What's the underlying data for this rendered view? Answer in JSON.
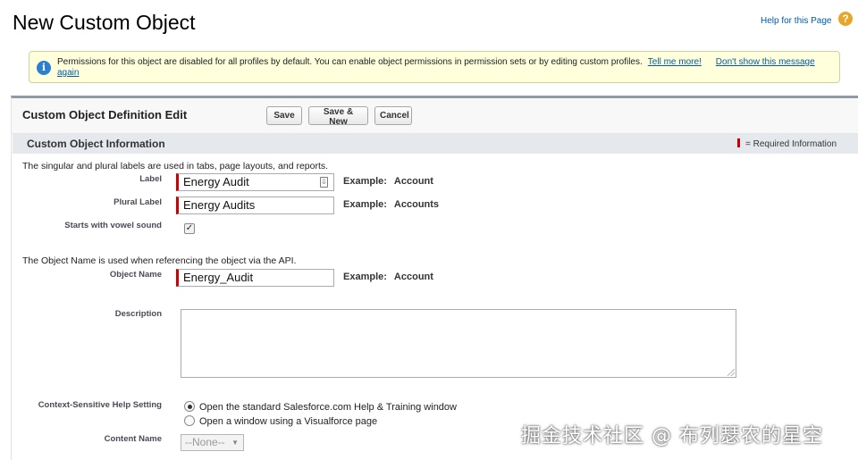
{
  "page": {
    "title": "New Custom Object",
    "help_link": "Help for this Page",
    "help_icon": "question-icon"
  },
  "notice": {
    "icon": "info-icon",
    "text": "Permissions for this object are disabled for all profiles by default. You can enable object permissions in permission sets or by editing custom profiles.",
    "tell_me_more": "Tell me more!",
    "dont_show": "Don't show this message again"
  },
  "edit": {
    "title": "Custom Object Definition Edit",
    "buttons": {
      "save": "Save",
      "save_new": "Save & New",
      "cancel": "Cancel"
    }
  },
  "section": {
    "title": "Custom Object Information",
    "required_legend": "= Required Information"
  },
  "labels_intro": "The singular and plural labels are used in tabs, page layouts, and reports.",
  "fields": {
    "label": {
      "label": "Label",
      "value": "Energy Audit",
      "example_label": "Example:",
      "example_value": "Account"
    },
    "plural_label": {
      "label": "Plural Label",
      "value": "Energy Audits",
      "example_label": "Example:",
      "example_value": "Accounts"
    },
    "vowel": {
      "label": "Starts with vowel sound",
      "checked": true
    },
    "object_name_intro": "The Object Name is used when referencing the object via the API.",
    "object_name": {
      "label": "Object Name",
      "value": "Energy_Audit",
      "example_label": "Example:",
      "example_value": "Account"
    },
    "description": {
      "label": "Description",
      "value": ""
    },
    "help_setting": {
      "label": "Context-Sensitive Help Setting",
      "options": [
        {
          "label": "Open the standard Salesforce.com Help & Training window",
          "selected": true
        },
        {
          "label": "Open a window using a Visualforce page",
          "selected": false
        }
      ]
    },
    "content_name": {
      "label": "Content Name",
      "value": "--None--"
    }
  },
  "watermark": "掘金技术社区 @ 布列瑟农的星空",
  "colors": {
    "required": "#cc0000",
    "link": "#015ba7",
    "section_bg": "#e5e9ee",
    "notice_bg": "#ffffdc"
  }
}
